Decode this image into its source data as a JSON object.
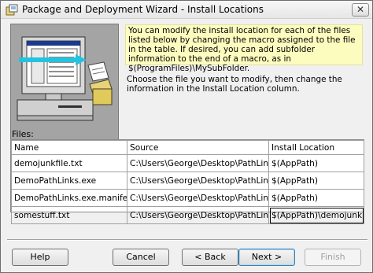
{
  "window": {
    "title": "Package and Deployment Wizard - Install Locations",
    "close_glyph": "✕"
  },
  "description": {
    "text1": "You can modify the install location for each of the files listed below by changing the macro assigned to the file in the table. If desired, you can add subfolder information to the end of a macro, as in $(ProgramFiles)\\MySubFolder.",
    "text2": "Choose the file you want to modify, then change the information in the Install Location column."
  },
  "files": {
    "label": "Files:",
    "columns": [
      "Name",
      "Source",
      "Install Location"
    ],
    "rows": [
      {
        "name": "demojunkfile.txt",
        "source": "C:\\Users\\George\\Desktop\\PathLinks\\F",
        "location": "$(AppPath)"
      },
      {
        "name": "DemoPathLinks.exe",
        "source": "C:\\Users\\George\\Desktop\\PathLinks\\F",
        "location": "$(AppPath)"
      },
      {
        "name": "DemoPathLinks.exe.manifest",
        "source": "C:\\Users\\George\\Desktop\\PathLinks\\F",
        "location": "$(AppPath)"
      },
      {
        "name": "somestuff.txt",
        "source": "C:\\Users\\George\\Desktop\\PathLinks\\F",
        "location": "$(AppPath)\\demojunk"
      }
    ]
  },
  "buttons": {
    "help": "Help",
    "cancel": "Cancel",
    "back": "< Back",
    "next": "Next >",
    "finish": "Finish"
  },
  "colors": {
    "info_background": "#fcfcbf",
    "artwork_background": "#a4a4a4"
  }
}
